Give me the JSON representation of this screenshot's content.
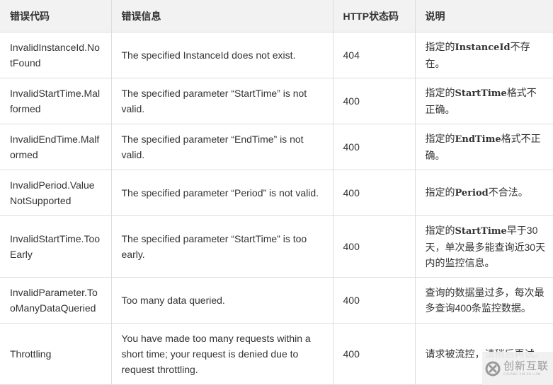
{
  "table": {
    "headers": [
      "错误代码",
      "错误信息",
      "HTTP状态码",
      "说明"
    ],
    "rows": [
      {
        "code": "InvalidInstanceId.NotFound",
        "message": "The specified InstanceId does not exist.",
        "status": "404",
        "desc_prefix": "指定的",
        "desc_code": "InstanceId",
        "desc_suffix": "不存在。"
      },
      {
        "code": "InvalidStartTime.Malformed",
        "message": "The specified parameter “StartTime” is not valid.",
        "status": "400",
        "desc_prefix": "指定的",
        "desc_code": "StartTime",
        "desc_suffix": "格式不正确。"
      },
      {
        "code": "InvalidEndTime.Malformed",
        "message": "The specified parameter “EndTime” is not valid.",
        "status": "400",
        "desc_prefix": "指定的",
        "desc_code": "EndTime",
        "desc_suffix": "格式不正确。"
      },
      {
        "code": "InvalidPeriod.ValueNotSupported",
        "message": "The specified parameter “Period” is not valid.",
        "status": "400",
        "desc_prefix": "指定的",
        "desc_code": "Period",
        "desc_suffix": "不合法。"
      },
      {
        "code": "InvalidStartTime.TooEarly",
        "message": "The specified parameter “StartTime” is too early.",
        "status": "400",
        "desc_prefix": "指定的",
        "desc_code": "StartTime",
        "desc_suffix": "早于30天，单次最多能查询近30天内的监控信息。"
      },
      {
        "code": "InvalidParameter.TooManyDataQueried",
        "message": "Too many data queried.",
        "status": "400",
        "desc_prefix": "查询的数据量过多，每次最多查询400条监控数据。",
        "desc_code": "",
        "desc_suffix": ""
      },
      {
        "code": "Throttling",
        "message": "You have made too many requests within a short time; your request is denied due to request throttling.",
        "status": "400",
        "desc_prefix": "请求被流控，请稍后再试。",
        "desc_code": "",
        "desc_suffix": ""
      }
    ]
  },
  "watermark": {
    "icon": "chuangxin-logo-icon",
    "text": "创新互联",
    "subtext": "CHUANG XIN HU LIAN"
  }
}
